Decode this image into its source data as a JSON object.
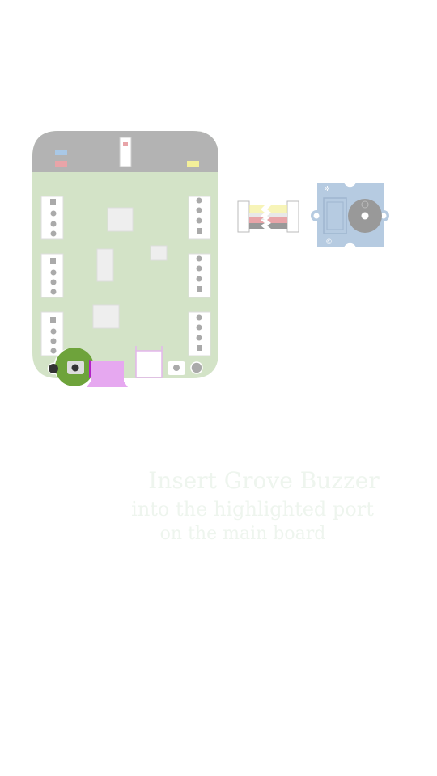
{
  "hint": {
    "line1": "Insert Grove Buzzer",
    "line2": "into the highlighted port",
    "line3": "on the main board"
  },
  "colors": {
    "board_green": "#d3e3c7",
    "board_top_gray": "#b3b3b3",
    "buzzer_blue": "#b6cbe1",
    "highlight_green": "#6ea33b",
    "highlight_magenta": "#e6a8f0"
  },
  "icons": {
    "main_board": "board-illustration",
    "cable": "grove-cable-illustration",
    "buzzer": "buzzer-module-illustration"
  }
}
